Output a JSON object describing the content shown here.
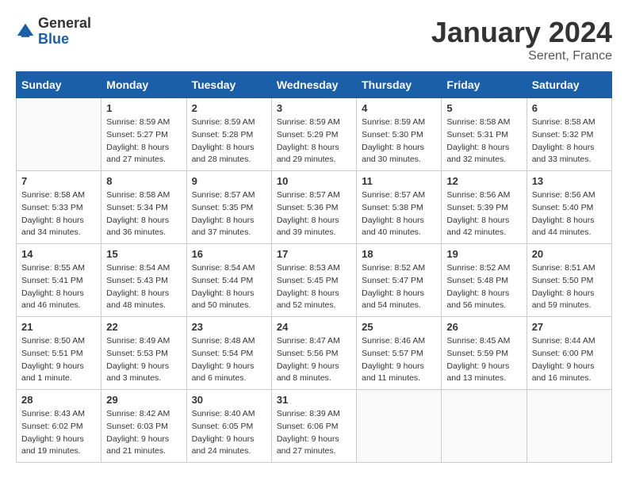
{
  "header": {
    "logo_general": "General",
    "logo_blue": "Blue",
    "month_year": "January 2024",
    "location": "Serent, France"
  },
  "days_of_week": [
    "Sunday",
    "Monday",
    "Tuesday",
    "Wednesday",
    "Thursday",
    "Friday",
    "Saturday"
  ],
  "weeks": [
    [
      {
        "day": "",
        "sunrise": "",
        "sunset": "",
        "daylight": ""
      },
      {
        "day": "1",
        "sunrise": "Sunrise: 8:59 AM",
        "sunset": "Sunset: 5:27 PM",
        "daylight": "Daylight: 8 hours and 27 minutes."
      },
      {
        "day": "2",
        "sunrise": "Sunrise: 8:59 AM",
        "sunset": "Sunset: 5:28 PM",
        "daylight": "Daylight: 8 hours and 28 minutes."
      },
      {
        "day": "3",
        "sunrise": "Sunrise: 8:59 AM",
        "sunset": "Sunset: 5:29 PM",
        "daylight": "Daylight: 8 hours and 29 minutes."
      },
      {
        "day": "4",
        "sunrise": "Sunrise: 8:59 AM",
        "sunset": "Sunset: 5:30 PM",
        "daylight": "Daylight: 8 hours and 30 minutes."
      },
      {
        "day": "5",
        "sunrise": "Sunrise: 8:58 AM",
        "sunset": "Sunset: 5:31 PM",
        "daylight": "Daylight: 8 hours and 32 minutes."
      },
      {
        "day": "6",
        "sunrise": "Sunrise: 8:58 AM",
        "sunset": "Sunset: 5:32 PM",
        "daylight": "Daylight: 8 hours and 33 minutes."
      }
    ],
    [
      {
        "day": "7",
        "sunrise": "Sunrise: 8:58 AM",
        "sunset": "Sunset: 5:33 PM",
        "daylight": "Daylight: 8 hours and 34 minutes."
      },
      {
        "day": "8",
        "sunrise": "Sunrise: 8:58 AM",
        "sunset": "Sunset: 5:34 PM",
        "daylight": "Daylight: 8 hours and 36 minutes."
      },
      {
        "day": "9",
        "sunrise": "Sunrise: 8:57 AM",
        "sunset": "Sunset: 5:35 PM",
        "daylight": "Daylight: 8 hours and 37 minutes."
      },
      {
        "day": "10",
        "sunrise": "Sunrise: 8:57 AM",
        "sunset": "Sunset: 5:36 PM",
        "daylight": "Daylight: 8 hours and 39 minutes."
      },
      {
        "day": "11",
        "sunrise": "Sunrise: 8:57 AM",
        "sunset": "Sunset: 5:38 PM",
        "daylight": "Daylight: 8 hours and 40 minutes."
      },
      {
        "day": "12",
        "sunrise": "Sunrise: 8:56 AM",
        "sunset": "Sunset: 5:39 PM",
        "daylight": "Daylight: 8 hours and 42 minutes."
      },
      {
        "day": "13",
        "sunrise": "Sunrise: 8:56 AM",
        "sunset": "Sunset: 5:40 PM",
        "daylight": "Daylight: 8 hours and 44 minutes."
      }
    ],
    [
      {
        "day": "14",
        "sunrise": "Sunrise: 8:55 AM",
        "sunset": "Sunset: 5:41 PM",
        "daylight": "Daylight: 8 hours and 46 minutes."
      },
      {
        "day": "15",
        "sunrise": "Sunrise: 8:54 AM",
        "sunset": "Sunset: 5:43 PM",
        "daylight": "Daylight: 8 hours and 48 minutes."
      },
      {
        "day": "16",
        "sunrise": "Sunrise: 8:54 AM",
        "sunset": "Sunset: 5:44 PM",
        "daylight": "Daylight: 8 hours and 50 minutes."
      },
      {
        "day": "17",
        "sunrise": "Sunrise: 8:53 AM",
        "sunset": "Sunset: 5:45 PM",
        "daylight": "Daylight: 8 hours and 52 minutes."
      },
      {
        "day": "18",
        "sunrise": "Sunrise: 8:52 AM",
        "sunset": "Sunset: 5:47 PM",
        "daylight": "Daylight: 8 hours and 54 minutes."
      },
      {
        "day": "19",
        "sunrise": "Sunrise: 8:52 AM",
        "sunset": "Sunset: 5:48 PM",
        "daylight": "Daylight: 8 hours and 56 minutes."
      },
      {
        "day": "20",
        "sunrise": "Sunrise: 8:51 AM",
        "sunset": "Sunset: 5:50 PM",
        "daylight": "Daylight: 8 hours and 59 minutes."
      }
    ],
    [
      {
        "day": "21",
        "sunrise": "Sunrise: 8:50 AM",
        "sunset": "Sunset: 5:51 PM",
        "daylight": "Daylight: 9 hours and 1 minute."
      },
      {
        "day": "22",
        "sunrise": "Sunrise: 8:49 AM",
        "sunset": "Sunset: 5:53 PM",
        "daylight": "Daylight: 9 hours and 3 minutes."
      },
      {
        "day": "23",
        "sunrise": "Sunrise: 8:48 AM",
        "sunset": "Sunset: 5:54 PM",
        "daylight": "Daylight: 9 hours and 6 minutes."
      },
      {
        "day": "24",
        "sunrise": "Sunrise: 8:47 AM",
        "sunset": "Sunset: 5:56 PM",
        "daylight": "Daylight: 9 hours and 8 minutes."
      },
      {
        "day": "25",
        "sunrise": "Sunrise: 8:46 AM",
        "sunset": "Sunset: 5:57 PM",
        "daylight": "Daylight: 9 hours and 11 minutes."
      },
      {
        "day": "26",
        "sunrise": "Sunrise: 8:45 AM",
        "sunset": "Sunset: 5:59 PM",
        "daylight": "Daylight: 9 hours and 13 minutes."
      },
      {
        "day": "27",
        "sunrise": "Sunrise: 8:44 AM",
        "sunset": "Sunset: 6:00 PM",
        "daylight": "Daylight: 9 hours and 16 minutes."
      }
    ],
    [
      {
        "day": "28",
        "sunrise": "Sunrise: 8:43 AM",
        "sunset": "Sunset: 6:02 PM",
        "daylight": "Daylight: 9 hours and 19 minutes."
      },
      {
        "day": "29",
        "sunrise": "Sunrise: 8:42 AM",
        "sunset": "Sunset: 6:03 PM",
        "daylight": "Daylight: 9 hours and 21 minutes."
      },
      {
        "day": "30",
        "sunrise": "Sunrise: 8:40 AM",
        "sunset": "Sunset: 6:05 PM",
        "daylight": "Daylight: 9 hours and 24 minutes."
      },
      {
        "day": "31",
        "sunrise": "Sunrise: 8:39 AM",
        "sunset": "Sunset: 6:06 PM",
        "daylight": "Daylight: 9 hours and 27 minutes."
      },
      {
        "day": "",
        "sunrise": "",
        "sunset": "",
        "daylight": ""
      },
      {
        "day": "",
        "sunrise": "",
        "sunset": "",
        "daylight": ""
      },
      {
        "day": "",
        "sunrise": "",
        "sunset": "",
        "daylight": ""
      }
    ]
  ]
}
